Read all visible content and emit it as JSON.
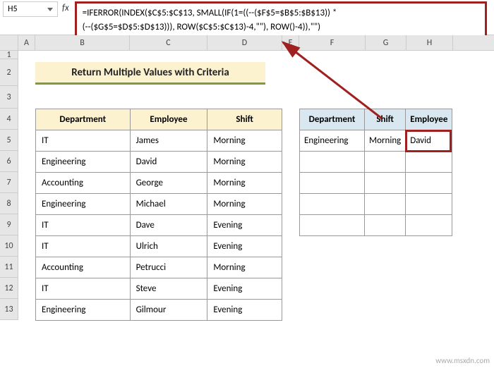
{
  "namebox": "H5",
  "fx": "fx",
  "formula_line1": "=IFERROR(INDEX($C$5:$C$13, SMALL(IF(1=((--($F$5=$B$5:$B$13)) *",
  "formula_line2": "(--($G$5=$D$5:$D$13))), ROW($C$5:$C$13)-4,\"\"), ROW()-4)),\"\")",
  "cols": [
    "A",
    "B",
    "C",
    "D",
    "E",
    "F",
    "G",
    "H"
  ],
  "rows": [
    "1",
    "2",
    "3",
    "4",
    "5",
    "6",
    "7",
    "8",
    "9",
    "10",
    "11",
    "12",
    "13"
  ],
  "title": "Return Multiple Values with Criteria",
  "table": {
    "headers": [
      "Department",
      "Employee",
      "Shift"
    ],
    "rows": [
      [
        "IT",
        "James",
        "Morning"
      ],
      [
        "Engineering",
        "David",
        "Morning"
      ],
      [
        "Accounting",
        "George",
        "Morning"
      ],
      [
        "Engineering",
        "Michael",
        "Morning"
      ],
      [
        "IT",
        "Dave",
        "Evening"
      ],
      [
        "IT",
        "Ulrich",
        "Evening"
      ],
      [
        "Accounting",
        "Petrucci",
        "Morning"
      ],
      [
        "IT",
        "Steve",
        "Evening"
      ],
      [
        "Engineering",
        "Gilmour",
        "Evening"
      ]
    ]
  },
  "lookup": {
    "headers": [
      "Department",
      "Shift",
      "Employee"
    ],
    "rows": [
      [
        "Engineering",
        "Morning",
        "David"
      ],
      [
        "",
        "",
        ""
      ],
      [
        "",
        "",
        ""
      ],
      [
        "",
        "",
        ""
      ],
      [
        "",
        "",
        ""
      ]
    ]
  },
  "watermark": "www.msxdn.com"
}
